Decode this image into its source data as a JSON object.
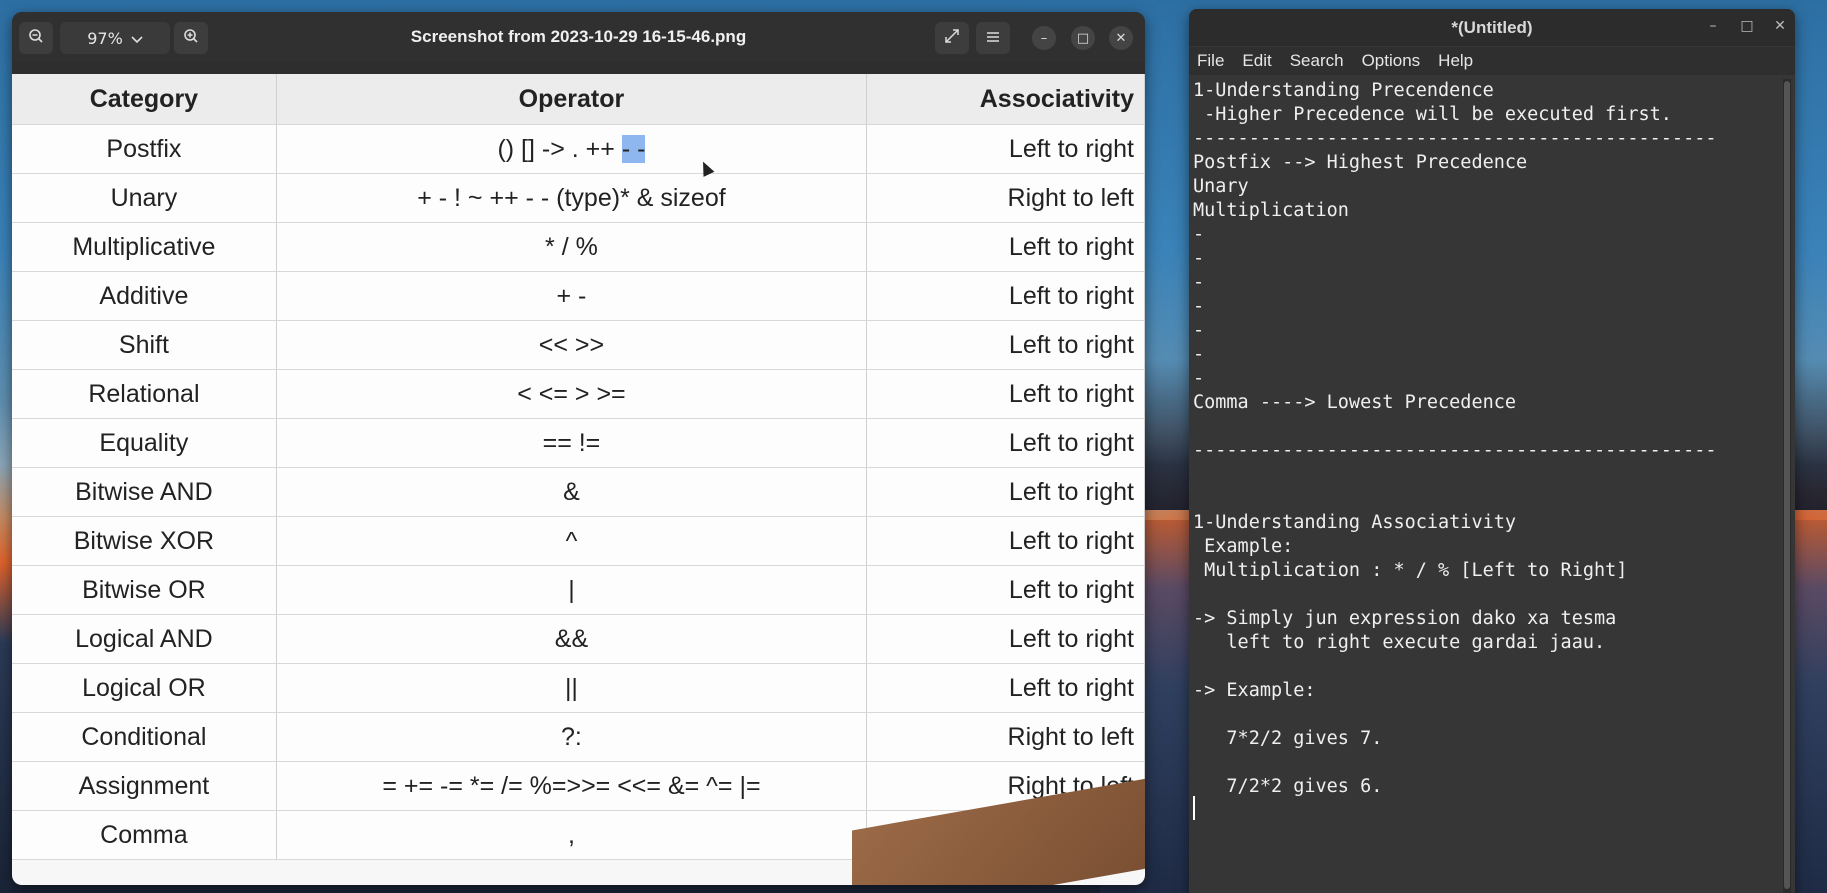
{
  "viewer": {
    "zoom": "97%",
    "title": "Screenshot from 2023-10-29 16-15-46.png",
    "table": {
      "headers": [
        "Category",
        "Operator",
        "Associativity"
      ],
      "rows": [
        {
          "category": "Postfix",
          "operator": "() [] -> . ++",
          "operator_highlight": "- -",
          "assoc": "Left to right"
        },
        {
          "category": "Unary",
          "operator": "+ - ! ~ ++ - - (type)* & sizeof",
          "assoc": "Right to left"
        },
        {
          "category": "Multiplicative",
          "operator": "* / %",
          "assoc": "Left to right"
        },
        {
          "category": "Additive",
          "operator": "+ -",
          "assoc": "Left to right"
        },
        {
          "category": "Shift",
          "operator": "<< >>",
          "assoc": "Left to right"
        },
        {
          "category": "Relational",
          "operator": "< <= > >=",
          "assoc": "Left to right"
        },
        {
          "category": "Equality",
          "operator": "== !=",
          "assoc": "Left to right"
        },
        {
          "category": "Bitwise AND",
          "operator": "&",
          "assoc": "Left to right"
        },
        {
          "category": "Bitwise XOR",
          "operator": "^",
          "assoc": "Left to right"
        },
        {
          "category": "Bitwise OR",
          "operator": "|",
          "assoc": "Left to right"
        },
        {
          "category": "Logical AND",
          "operator": "&&",
          "assoc": "Left to right"
        },
        {
          "category": "Logical OR",
          "operator": "||",
          "assoc": "Left to right"
        },
        {
          "category": "Conditional",
          "operator": "?:",
          "assoc": "Right to left"
        },
        {
          "category": "Assignment",
          "operator": "= += -= *= /= %=>>= <<= &= ^= |=",
          "assoc": "Right to left"
        },
        {
          "category": "Comma",
          "operator": ",",
          "assoc": ""
        }
      ]
    }
  },
  "editor": {
    "title": "*(Untitled)",
    "menu": [
      "File",
      "Edit",
      "Search",
      "Options",
      "Help"
    ],
    "lines": [
      "1-Understanding Precendence",
      " -Higher Precedence will be executed first.",
      "-----------------------------------------------",
      "Postfix --> Highest Precedence",
      "Unary",
      "Multiplication",
      "-",
      "-",
      "-",
      "-",
      "-",
      "-",
      "-",
      "Comma ----> Lowest Precedence",
      "",
      "-----------------------------------------------",
      "",
      "",
      "1-Understanding Associativity",
      " Example:",
      " Multiplication : * / % [Left to Right]",
      "",
      "-> Simply jun expression dako xa tesma",
      "   left to right execute gardai jaau.",
      "",
      "-> Example:",
      "",
      "   7*2/2 gives 7.",
      "",
      "   7/2*2 gives 6.",
      ""
    ]
  }
}
